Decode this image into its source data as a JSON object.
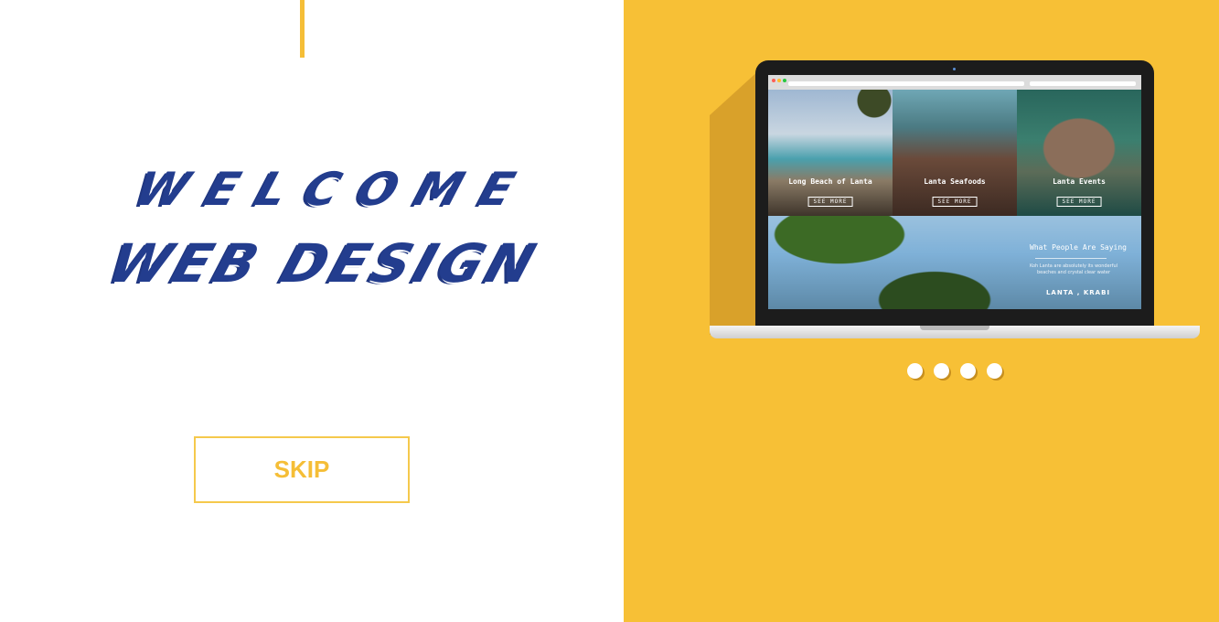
{
  "hero": {
    "line1": "WELCOME",
    "line2": "WEB DESIGN"
  },
  "skip_label": "SKIP",
  "colors": {
    "accent": "#F5BE37",
    "panel": "#F7C036",
    "headline": "#233D8E"
  },
  "laptop_preview": {
    "tiles": [
      {
        "title": "Long Beach of Lanta",
        "button": "SEE MORE"
      },
      {
        "title": "Lanta Seafoods",
        "button": "SEE MORE"
      },
      {
        "title": "Lanta Events",
        "button": "SEE MORE"
      }
    ],
    "testimonial": {
      "title": "What People Are Saying",
      "body": "Koh Lanta are absolutely its wonderful beaches and crystal clear water",
      "place": "LANTA , KRABI"
    }
  },
  "pager": {
    "count": 4,
    "active_index": 0
  }
}
